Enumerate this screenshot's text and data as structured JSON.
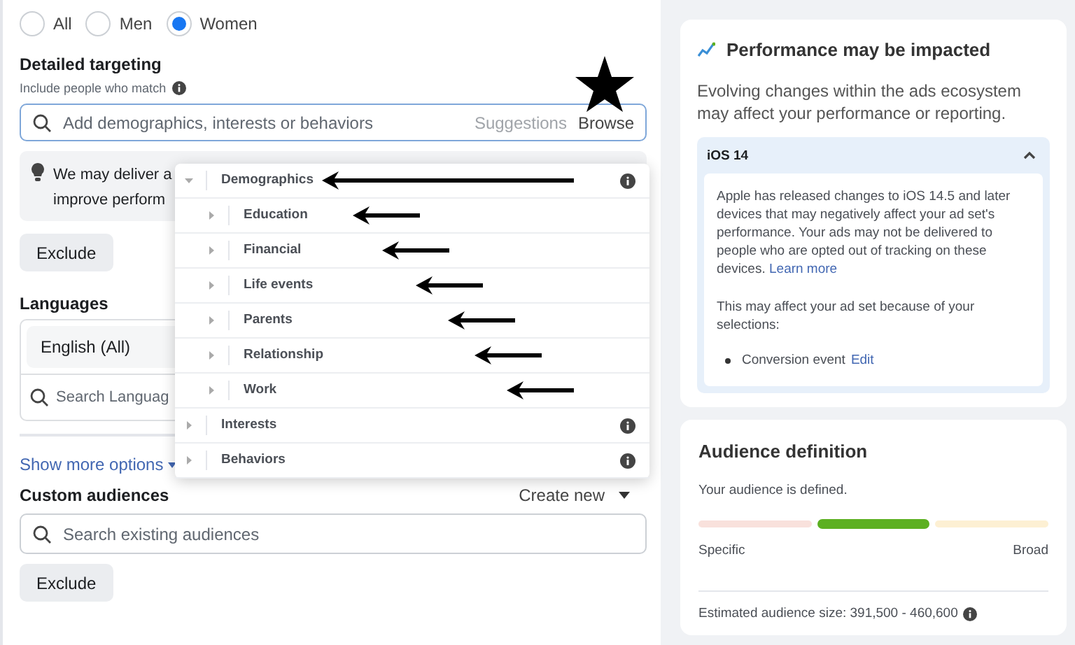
{
  "gender": [
    {
      "label": "All",
      "selected": false
    },
    {
      "label": "Men",
      "selected": false
    },
    {
      "label": "Women",
      "selected": true
    }
  ],
  "detailed_targeting": {
    "title": "Detailed targeting",
    "subtitle": "Include people who match",
    "search": {
      "placeholder": "Add demographics, interests or behaviors"
    },
    "suggestions": "Suggestions",
    "browse": "Browse",
    "browse_starred": true,
    "tip": "We may deliver a\nimprove perform",
    "exclude": "Exclude",
    "browse_tree": [
      {
        "label": "Demographics",
        "expanded": true,
        "arrow": true,
        "children": [
          {
            "label": "Education",
            "expanded": false,
            "arrow": true
          },
          {
            "label": "Financial",
            "expanded": false,
            "arrow": true
          },
          {
            "label": "Life events",
            "expanded": false,
            "arrow": true
          },
          {
            "label": "Parents",
            "expanded": false,
            "arrow": true
          },
          {
            "label": "Relationship",
            "expanded": false,
            "arrow": true
          },
          {
            "label": "Work",
            "expanded": false,
            "arrow": true
          }
        ]
      },
      {
        "label": "Interests",
        "expanded": false,
        "arrow": false
      },
      {
        "label": "Behaviors",
        "expanded": false,
        "arrow": false
      }
    ]
  },
  "languages": {
    "title": "Languages",
    "selected_language": "English (All)",
    "search": {
      "placeholder": "Search Languag"
    }
  },
  "show_more": "Show more options",
  "custom_audiences": {
    "title": "Custom audiences",
    "create_new": "Create new",
    "search": {
      "placeholder": "Search existing audiences"
    },
    "exclude": "Exclude"
  },
  "performance": {
    "title": "Performance may be impacted",
    "description": "Evolving changes within the ads ecosystem may affect your performance or reporting.",
    "section": {
      "title": "iOS 14",
      "expanded": true,
      "body": "Apple has released changes to iOS 14.5 and later devices that may negatively affect your ad set's performance. Your ads may not be delivered to people who are opted out of tracking on these devices.",
      "learn_more": "Learn more",
      "note": "This may affect your ad set because of your selections:",
      "items": [
        {
          "label": "Conversion event",
          "link": "Edit"
        }
      ]
    }
  },
  "audience": {
    "title": "Audience definition",
    "status": "Your audience is defined.",
    "segments": [
      {
        "color": "#f9e1dc",
        "selected": false
      },
      {
        "color": "#5cb021",
        "selected": true
      },
      {
        "color": "#fdf0d3",
        "selected": false
      }
    ],
    "specific": "Specific",
    "broad": "Broad",
    "estimate": "Estimated audience size: 391,500 - 460,600"
  }
}
